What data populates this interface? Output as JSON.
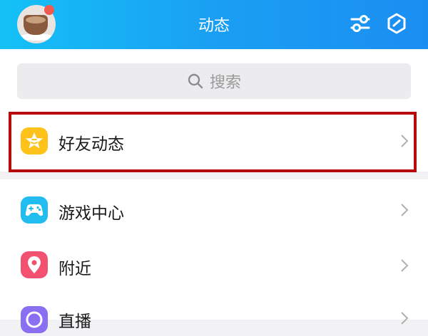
{
  "header": {
    "title": "动态",
    "left_icon": "avatar",
    "right_icons": [
      "settings-sliders-icon",
      "hexagon-check-icon"
    ]
  },
  "search": {
    "placeholder": "搜索",
    "icon": "search-icon"
  },
  "items": [
    {
      "label": "好友动态",
      "icon": "star-face-icon",
      "color": "#ffc21a",
      "highlighted": true
    },
    {
      "label": "游戏中心",
      "icon": "gamepad-icon",
      "color": "#21bdf1"
    },
    {
      "label": "附近",
      "icon": "location-pin-icon",
      "color": "#f2526f"
    },
    {
      "label": "直播",
      "icon": "live-icon",
      "color": "#8b6ff3"
    }
  ],
  "colors": {
    "header_gradient_start": "#14c1f6",
    "header_gradient_end": "#1b8ef2",
    "highlight_border": "#b80a0a"
  }
}
